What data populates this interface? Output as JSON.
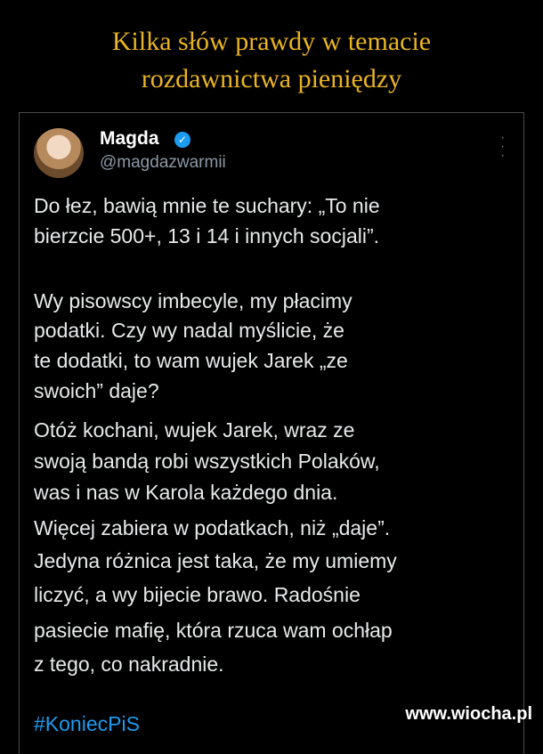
{
  "headline": [
    "Kilka słów prawdy w temacie",
    "rozdawnictwa pieniędzy"
  ],
  "post": {
    "author": "Magda",
    "handle": "@magdazwarmii",
    "lines": [
      "Do łez, bawią mnie te suchary: „To nie",
      "bierzcie 500+, 13 i 14 i innych socjali”.",
      "",
      "Wy pisowscy imbecyle, my płacimy",
      "podatki. Czy wy nadal myślicie, że",
      "te dodatki, to wam wujek Jarek „ze",
      "swoich” daje?",
      "Otóż kochani, wujek Jarek, wraz ze",
      "swoją bandą robi wszystkich Polaków,",
      "was i nas w Karola każdego dnia.",
      "Więcej zabiera w podatkach, niż „daje”.",
      "Jedyna różnica jest taka, że my umiemy",
      "liczyć, a wy bijecie brawo. Radośnie",
      "pasiecie mafię, która rzuca wam ochłap",
      "z tego, co nakradnie."
    ],
    "hashtag": "#KoniecPiS"
  },
  "watermark": "www.wiocha.pl",
  "icons": {
    "verified": "verified-badge-icon",
    "more": "more-options-icon"
  },
  "colors": {
    "headline": "#e9b422",
    "link": "#1d9bf0",
    "text": "#e7e9ea",
    "muted": "#8b98a5"
  }
}
